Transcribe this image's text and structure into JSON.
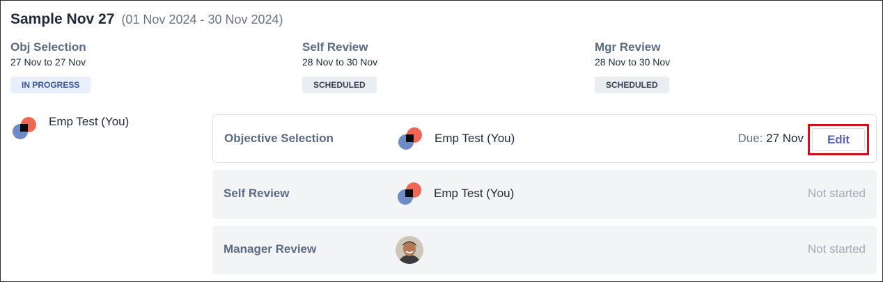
{
  "header": {
    "title": "Sample Nov 27",
    "date_range": "(01 Nov 2024 - 30 Nov 2024)"
  },
  "phases": [
    {
      "name": "Obj Selection",
      "dates": "27 Nov to 27 Nov",
      "status": "IN PROGRESS"
    },
    {
      "name": "Self Review",
      "dates": "28 Nov to 30 Nov",
      "status": "SCHEDULED"
    },
    {
      "name": "Mgr Review",
      "dates": "28 Nov to 30 Nov",
      "status": "SCHEDULED"
    }
  ],
  "owner": {
    "name": "Emp Test (You)"
  },
  "stages": [
    {
      "name": "Objective Selection",
      "person": "Emp Test (You)",
      "due_label": "Due:",
      "due_value": "27 Nov",
      "action": "Edit"
    },
    {
      "name": "Self Review",
      "person": "Emp Test (You)",
      "status": "Not started"
    },
    {
      "name": "Manager Review",
      "person": "",
      "status": "Not started"
    }
  ],
  "colors": {
    "accent_red": "#d0101a",
    "logo_red": "#ef6654",
    "logo_blue": "#6d8bc4",
    "edit_text": "#5a64b8",
    "in_progress_bg": "#e8eefc"
  }
}
